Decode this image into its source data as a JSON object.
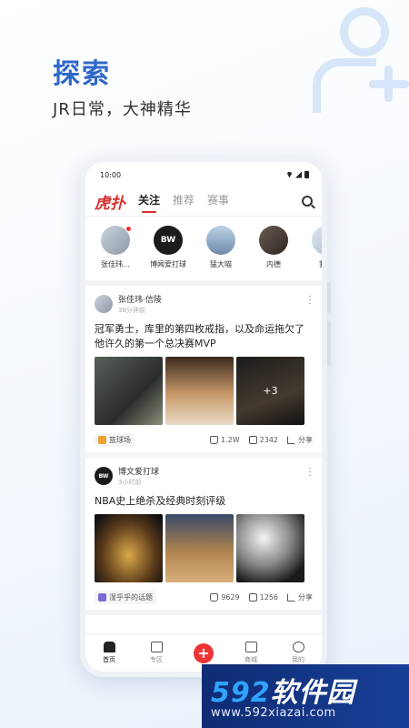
{
  "hero": {
    "title": "探索",
    "subtitle": "JR日常，大神精华"
  },
  "status_bar": {
    "time": "10:00"
  },
  "header": {
    "logo": "虎扑",
    "tabs": [
      {
        "label": "关注",
        "active": true
      },
      {
        "label": "推荐",
        "active": false
      },
      {
        "label": "赛事",
        "active": false
      }
    ]
  },
  "stories": [
    {
      "label": "张佳玮…",
      "badge": true
    },
    {
      "label": "博闻爱打球",
      "badge": false,
      "avatar_text": "BW"
    },
    {
      "label": "猛大喵",
      "badge": false
    },
    {
      "label": "内德",
      "badge": false
    },
    {
      "label": "我是",
      "badge": false
    }
  ],
  "posts": [
    {
      "author": "张佳玮·信陵",
      "time": "38分钟前",
      "title": "冠军勇士，库里的第四枚戒指，以及命运拖欠了他许久的第一个总决赛MVP",
      "more_count": "+3",
      "topic": "篮球场",
      "likes": "1.2W",
      "comments": "2342",
      "share": "分享"
    },
    {
      "author": "博文爱打球",
      "author_avatar_text": "BW",
      "time": "3小时前",
      "title": "NBA史上绝杀及经典时刻评级",
      "topic": "湿乎乎的话题",
      "likes": "9629",
      "comments": "1256",
      "share": "分享"
    }
  ],
  "bottom_nav": [
    {
      "label": "首页",
      "active": true
    },
    {
      "label": "专区",
      "active": false
    },
    {
      "label": "+",
      "post_button": true
    },
    {
      "label": "商城",
      "active": false
    },
    {
      "label": "我的",
      "active": false
    }
  ],
  "watermark": {
    "brand_num": "592",
    "brand_text": "软件园",
    "url": "www.592xiazai.com"
  },
  "colors": {
    "accent_red": "#e33333",
    "hero_blue": "#2f68c9"
  }
}
